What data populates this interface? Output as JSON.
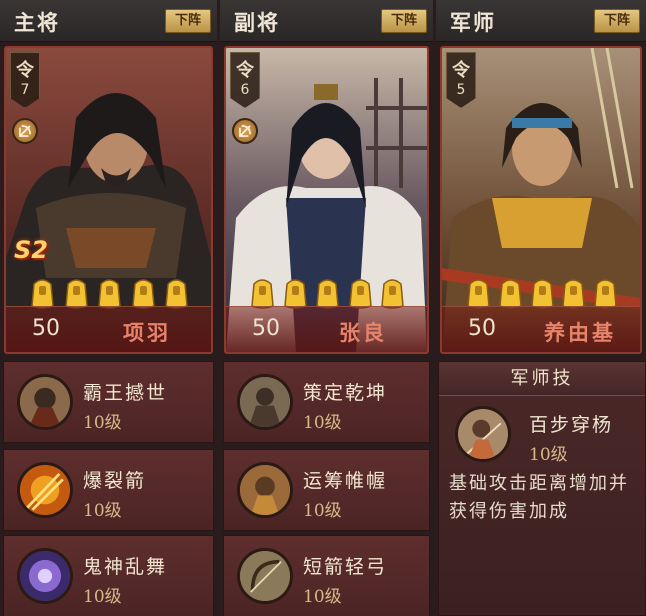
{
  "columns": [
    {
      "title": "主将",
      "button": "下阵",
      "command_char": "令",
      "command_value": "7",
      "badge": "S2",
      "level": "50",
      "name": "项羽",
      "skills": [
        {
          "name": "霸王撼世",
          "level": "10级"
        },
        {
          "name": "爆裂箭",
          "level": "10级"
        },
        {
          "name": "鬼神乱舞",
          "level": "10级"
        }
      ]
    },
    {
      "title": "副将",
      "button": "下阵",
      "command_char": "令",
      "command_value": "6",
      "level": "50",
      "name": "张良",
      "skills": [
        {
          "name": "策定乾坤",
          "level": "10级"
        },
        {
          "name": "运筹帷幄",
          "level": "10级"
        },
        {
          "name": "短箭轻弓",
          "level": "10级"
        }
      ]
    },
    {
      "title": "军师",
      "button": "下阵",
      "command_char": "令",
      "command_value": "5",
      "level": "50",
      "name": "养由基"
    }
  ],
  "strategist_skill": {
    "header": "军师技",
    "name": "百步穿杨",
    "level": "10级",
    "description": "基础攻击距离增加并获得伤害加成"
  },
  "star_count": 5,
  "colors": {
    "card_border": "#8c3a2e",
    "name_text": "#e7836b",
    "star_gold": "#f2c232"
  }
}
